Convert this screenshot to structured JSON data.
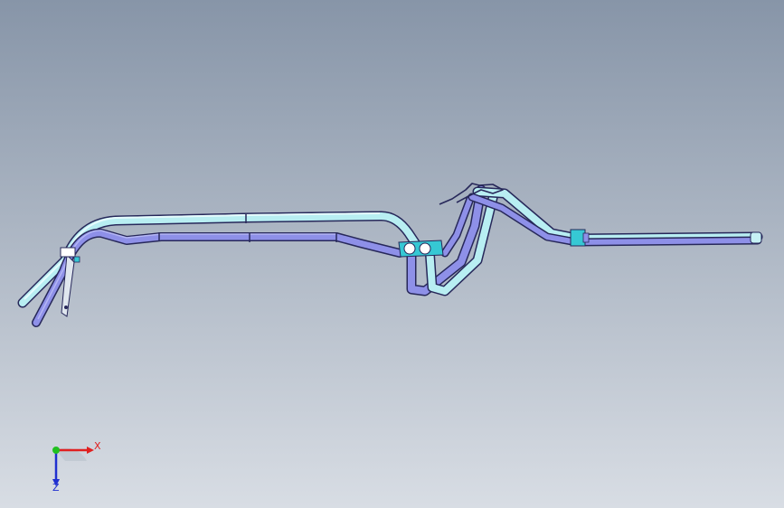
{
  "viewport": {
    "background_top": "#8795a8",
    "background_bottom": "#d8dde4"
  },
  "model": {
    "tube_light": "#b8eef2",
    "tube_dark": "#8e90e8",
    "edge_color": "#27285a",
    "clip_color": "#36c8d4"
  },
  "triad": {
    "x_label": "X",
    "z_label": "Z",
    "x_color": "#e02020",
    "y_color": "#20c020",
    "z_color": "#2030d0"
  }
}
